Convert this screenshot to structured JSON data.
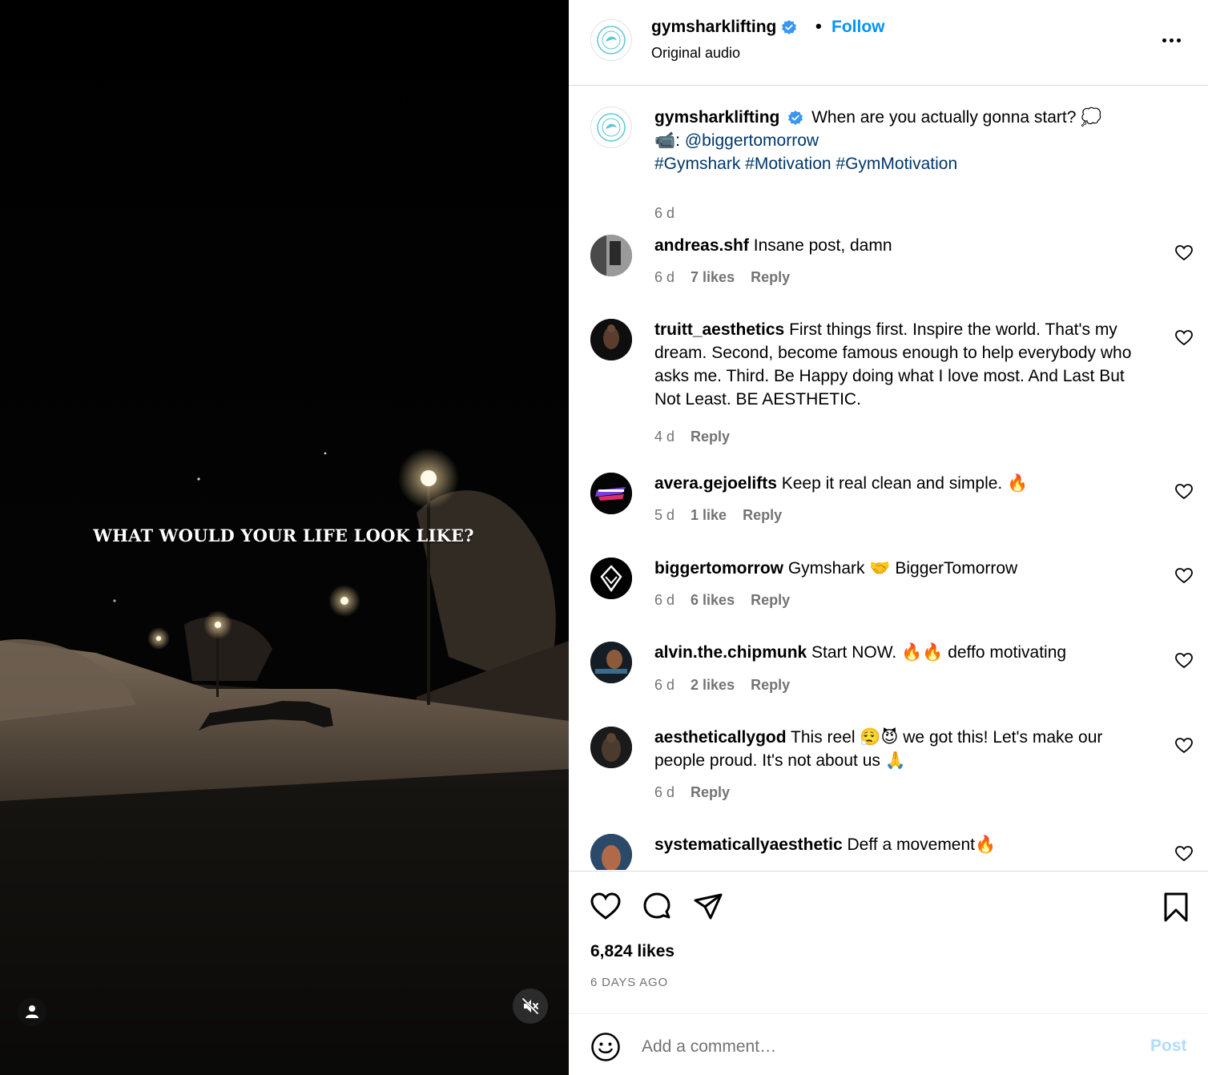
{
  "video": {
    "caption": "WHAT WOULD YOUR LIFE LOOK LIKE?",
    "profile_icon": "user-icon",
    "mute_icon": "speaker-muted-icon"
  },
  "header": {
    "username": "gymsharklifting",
    "separator": "•",
    "follow_label": "Follow",
    "audio": "Original audio",
    "more_icon": "more-horizontal-icon"
  },
  "caption": {
    "username": "gymsharklifting",
    "text": "When are you actually gonna start? 💭",
    "credit_prefix": "📹: ",
    "mention": "@biggertomorrow",
    "hashtags": "#Gymshark #Motivation #GymMotivation",
    "time": "6 d"
  },
  "comments": [
    {
      "username": "andreas.shf",
      "text": "Insane post, damn",
      "time": "6 d",
      "likes": "7 likes",
      "reply": "Reply"
    },
    {
      "username": "truitt_aesthetics",
      "text": "First things first. Inspire the world. That's my dream. Second, become famous enough to help everybody who asks me. Third. Be Happy doing what I love most. And Last But Not Least. BE AESTHETIC.",
      "time": "4 d",
      "likes": "",
      "reply": "Reply"
    },
    {
      "username": "avera.gejoelifts",
      "text": "Keep it real clean and simple. 🔥",
      "time": "5 d",
      "likes": "1 like",
      "reply": "Reply"
    },
    {
      "username": "biggertomorrow",
      "text": "Gymshark 🤝 BiggerTomorrow",
      "time": "6 d",
      "likes": "6 likes",
      "reply": "Reply"
    },
    {
      "username": "alvin.the.chipmunk",
      "text": "Start NOW. 🔥🔥 deffo motivating",
      "time": "6 d",
      "likes": "2 likes",
      "reply": "Reply"
    },
    {
      "username": "aestheticallygod",
      "text": "This reel 😮‍💨😈 we got this! Let's make our people proud. It's not about us 🙏",
      "time": "6 d",
      "likes": "",
      "reply": "Reply"
    },
    {
      "username": "systematicallyaesthetic",
      "text": "Deff a movement🔥",
      "time": "",
      "likes": "",
      "reply": ""
    }
  ],
  "actions": {
    "like_icon": "heart-icon",
    "comment_icon": "comment-bubble-icon",
    "share_icon": "paper-plane-icon",
    "save_icon": "bookmark-icon",
    "likes": "6,824 likes",
    "posted": "6 DAYS AGO"
  },
  "add_comment": {
    "emoji_icon": "smiley-icon",
    "placeholder": "Add a comment…",
    "post_label": "Post"
  },
  "colors": {
    "link_blue": "#0095f6",
    "verified_blue": "#3897f0",
    "muted_text": "#737373",
    "post_disabled": "#b3dbff",
    "hashtag": "#00376b"
  }
}
